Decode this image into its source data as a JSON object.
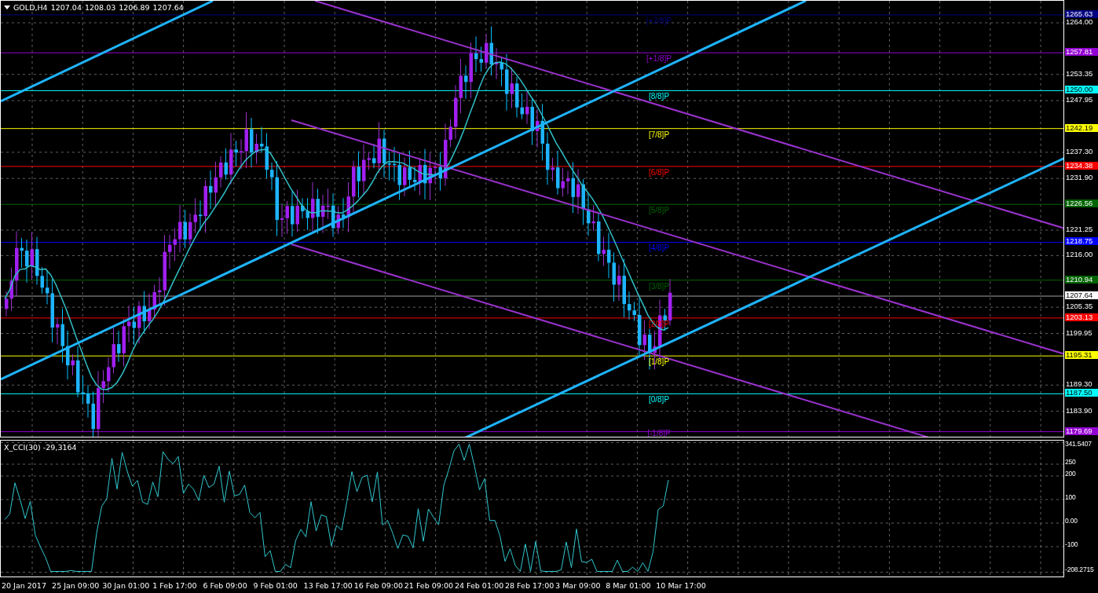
{
  "header": {
    "symbol": "GOLD,H4",
    "ohlc": [
      "1207.04",
      "1208.03",
      "1206.89",
      "1207.64"
    ]
  },
  "levels": [
    {
      "label": "[+2/8]P",
      "price": "1265.63",
      "color": "#000080"
    },
    {
      "label": "[+1/8]P",
      "price": "1257.81",
      "color": "#9400d3"
    },
    {
      "label": "[8/8]P",
      "price": "1250.00",
      "color": "#00ffff"
    },
    {
      "label": "[7/8]P",
      "price": "1242.19",
      "color": "#ffff00"
    },
    {
      "label": "[6/8]P",
      "price": "1234.38",
      "color": "#ff0000"
    },
    {
      "label": "[5/8]P",
      "price": "1226.56",
      "color": "#006400"
    },
    {
      "label": "[4/8]P",
      "price": "1218.75",
      "color": "#0000ff"
    },
    {
      "label": "[3/8]P",
      "price": "1210.94",
      "color": "#006400"
    },
    {
      "label": "[2/8]P",
      "price": "1203.13",
      "color": "#ff0000"
    },
    {
      "label": "[1/8]P",
      "price": "1195.31",
      "color": "#ffff00"
    },
    {
      "label": "[0/8]P",
      "price": "1187.50",
      "color": "#00ffff"
    },
    {
      "label": "[-1/8]P",
      "price": "1179.69",
      "color": "#9400d3"
    }
  ],
  "current_price": "1207.64",
  "price_axis": [
    "1264.00",
    "1253.35",
    "1247.95",
    "1237.30",
    "1231.90",
    "1221.25",
    "1216.00",
    "1205.35",
    "1199.95",
    "1189.30",
    "1183.90"
  ],
  "cci": {
    "title": "X_CCI(30) -29,3164",
    "axis": [
      "341.5407",
      "250",
      "200",
      "100",
      "0.00",
      "-100",
      "-208.2715"
    ]
  },
  "time_axis": [
    "20 Jan 2017",
    "25 Jan 09:00",
    "30 Jan 01:00",
    "1 Feb 17:00",
    "6 Feb 09:00",
    "9 Feb 01:00",
    "13 Feb 17:00",
    "16 Feb 09:00",
    "21 Feb 09:00",
    "24 Feb 01:00",
    "28 Feb 17:00",
    "3 Mar 09:00",
    "8 Mar 01:00",
    "10 Mar 17:00"
  ]
}
